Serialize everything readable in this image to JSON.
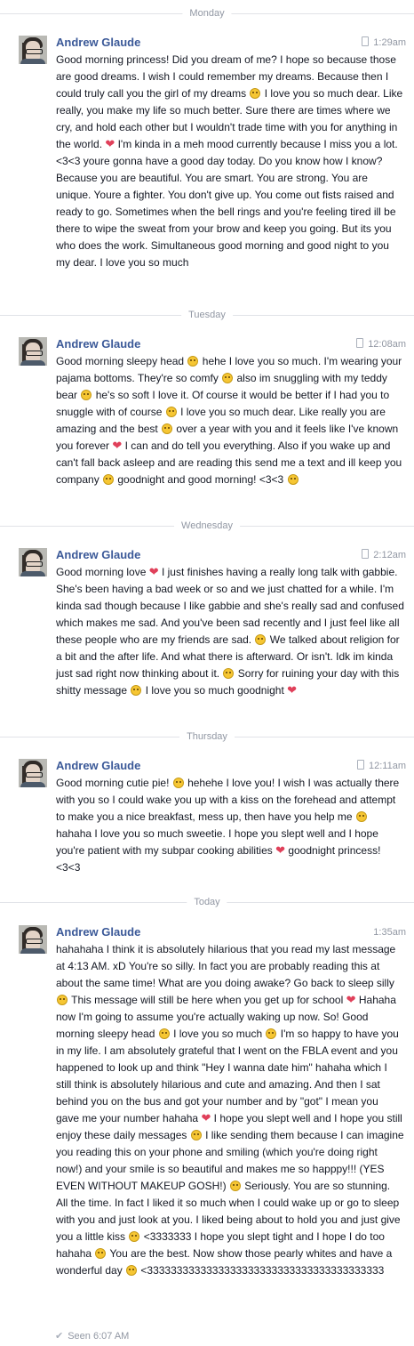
{
  "separators": [
    "Monday",
    "Tuesday",
    "Wednesday",
    "Thursday",
    "Today"
  ],
  "sender": "Andrew Glaude",
  "messages": [
    {
      "time": "1:29am",
      "text": "Good morning princess! Did you dream of me? I hope so because those are good dreams. I wish I could remember my dreams. Because then I could truly call you the girl of my dreams 🙂 I love you so much dear. Like really, you make my life so much better. Sure there are times where we cry, and hold each other but I wouldn't trade time with you for anything in the world. ❤ I'm kinda in a meh mood currently because I miss you a lot. <3<3 youre gonna have a good day today. Do you know how I know? Because you are beautiful. You are smart. You are strong. You are unique. Youre a fighter. You don't give up. You come out fists raised and ready to go. Sometimes when the bell rings and you're feeling tired ill be there to wipe the sweat from your brow and keep you going. But its you who does the work. Simultaneous good morning and good night to you my dear. I love you so much"
    },
    {
      "time": "12:08am",
      "text": "Good morning sleepy head 🙂 hehe I love you so much. I'm wearing your pajama bottoms. They're so comfy 🙂 also im snuggling with my teddy bear 🙂 he's so soft I love it. Of course it would be better if I had you to snuggle with of course 🙂 I love you so much dear. Like really you are amazing and the best 🙂 over a year with you and it feels like I've known you forever ❤ I can and do tell you everything. Also if you wake up and can't fall back asleep and are reading this send me a text and ill keep you company 🙂 goodnight and good morning! <3<3 😃"
    },
    {
      "time": "2:12am",
      "text": "Good morning love ❤ I just finishes having a really long talk with gabbie. She's been having a bad week or so and we just chatted for a while. I'm kinda sad though because I like gabbie and she's really sad and confused which makes me sad. And you've been sad recently and I just feel like all these people who are my friends are sad. 🙁 We talked about religion for a bit and the after life. And what there is afterward. Or isn't. Idk im kinda just sad right now thinking about it. 🙁 Sorry for ruining your day with this shitty message 🙁 I love you so much goodnight ❤"
    },
    {
      "time": "12:11am",
      "text": "Good morning cutie pie! 😃 hehehe I love you! I wish I was actually there with you so I could wake you up with a kiss on the forehead and attempt to make you a nice breakfast, mess up, then have you help me 🙂 hahaha I love you so much sweetie. I hope you slept well and I hope you're patient with my subpar cooking abilities ❤ goodnight princess! <3<3"
    },
    {
      "time": "1:35am",
      "text": "hahahaha I think it is absolutely hilarious that you read my last message at 4:13 AM. xD You're so silly. In fact you are probably reading this at about the same time! What are you doing awake? Go back to sleep silly 🙂 This message will still be here when you get up for school ❤ Hahaha now I'm going to assume you're actually waking up now. So! Good morning sleepy head 🙂 I love you so much 😃 I'm so happy to have you in my life. I am absolutely grateful that I went on the FBLA event and you happened to look up and think \"Hey I wanna date him\" hahaha which I still think is absolutely hilarious and cute and amazing. And then I sat behind you on the bus and got your number and by \"got\" I mean you gave me your number hahaha ❤ I hope you slept well and I hope you still enjoy these daily messages 🙂 I like sending them because I can imagine you reading this on your phone and smiling (which you're doing right now!) and your smile is so beautiful and makes me so happpy!!! (YES EVEN WITHOUT MAKEUP GOSH!) 🙂 Seriously. You are so stunning. All the time. In fact I liked it so much when I could wake up or go to sleep with you and just look at you. I liked being about to hold you and just give you a little kiss 🙂 <3333333 I hope you slept tight and I hope I do too hahaha 🙂 You are the best. Now show those pearly whites and have a wonderful day 🙂 <3333333333333333333333333333333333333333"
    }
  ],
  "seen": "Seen 6:07 AM",
  "icons": {
    "avatar": "profile-photo",
    "device": "mobile-phone-icon",
    "seen": "checkmark-icon"
  },
  "colors": {
    "name": "#3b5998",
    "meta": "#9197a3"
  }
}
